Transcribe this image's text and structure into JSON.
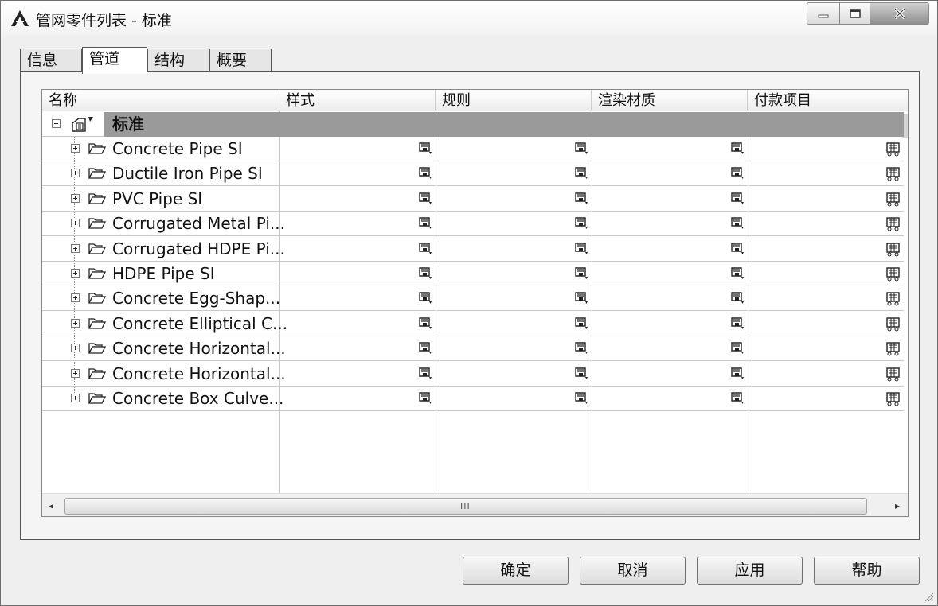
{
  "window": {
    "title": "管网零件列表 - 标准"
  },
  "tabs": [
    {
      "label": "信息"
    },
    {
      "label": "管道"
    },
    {
      "label": "结构"
    },
    {
      "label": "概要"
    }
  ],
  "active_tab": "管道",
  "grid": {
    "columns": [
      "名称",
      "样式",
      "规则",
      "渲染材质",
      "付款项目"
    ],
    "root": {
      "label": "标准"
    },
    "rows": [
      {
        "name": "Concrete Pipe SI"
      },
      {
        "name": "Ductile Iron Pipe SI"
      },
      {
        "name": "PVC Pipe SI"
      },
      {
        "name": "Corrugated Metal Pi..."
      },
      {
        "name": "Corrugated HDPE Pi..."
      },
      {
        "name": "HDPE Pipe SI"
      },
      {
        "name": "Concrete Egg-Shap..."
      },
      {
        "name": "Concrete Elliptical C..."
      },
      {
        "name": "Concrete Horizontal..."
      },
      {
        "name": "Concrete Horizontal..."
      },
      {
        "name": "Concrete Box Culve..."
      }
    ],
    "scrollbar_grip": "III"
  },
  "buttons": {
    "ok": "确定",
    "cancel": "取消",
    "apply": "应用",
    "help": "帮助"
  },
  "icons": {
    "app": "autocad-a-icon",
    "row_expand": "plus-expander-icon",
    "folder": "open-folder-icon",
    "style_cell": "style-picker-icon",
    "pay_item_cell": "pay-item-icon"
  }
}
